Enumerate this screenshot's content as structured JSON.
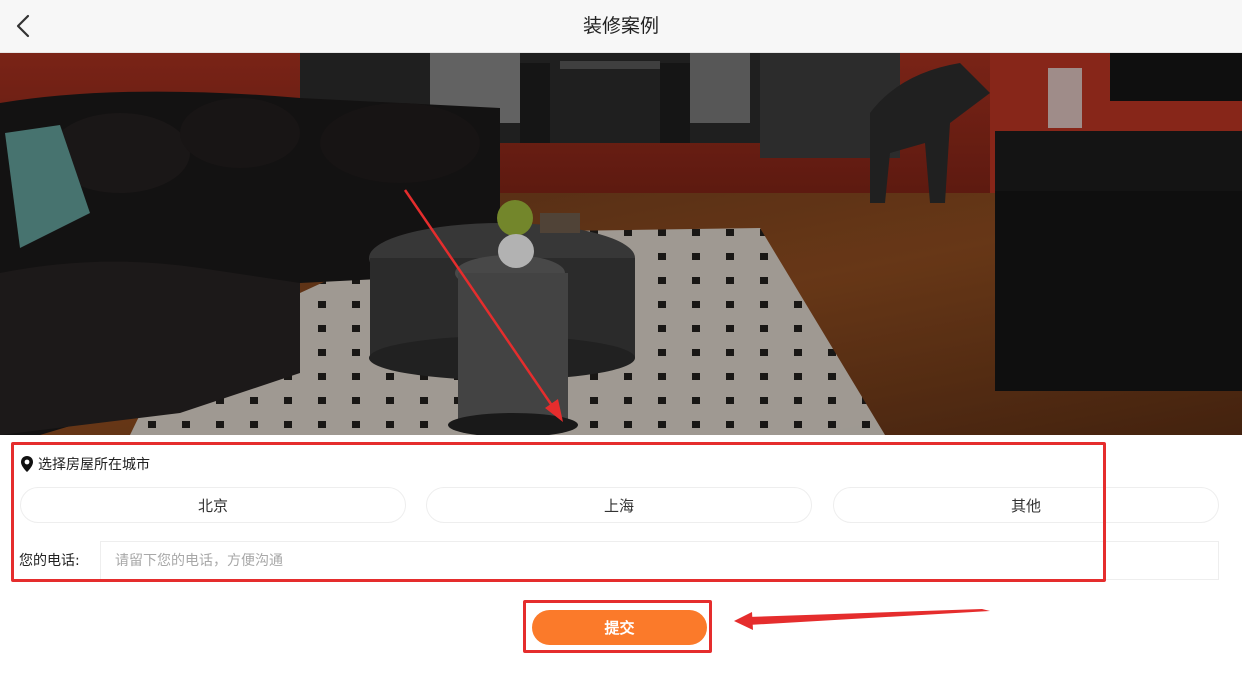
{
  "header": {
    "title": "装修案例",
    "back_icon": "chevron-left-icon"
  },
  "hero": {
    "description_icon": "living-room-photo"
  },
  "form": {
    "city_label": "选择房屋所在城市",
    "city_icon": "location-pin-icon",
    "cities": [
      "北京",
      "上海",
      "其他"
    ],
    "phone_label": "您的电话:",
    "phone_placeholder": "请留下您的电话，方便沟通",
    "phone_value": ""
  },
  "submit": {
    "label": "提交"
  },
  "colors": {
    "accent": "#fb7a2a",
    "annotation": "#e52d2d"
  }
}
